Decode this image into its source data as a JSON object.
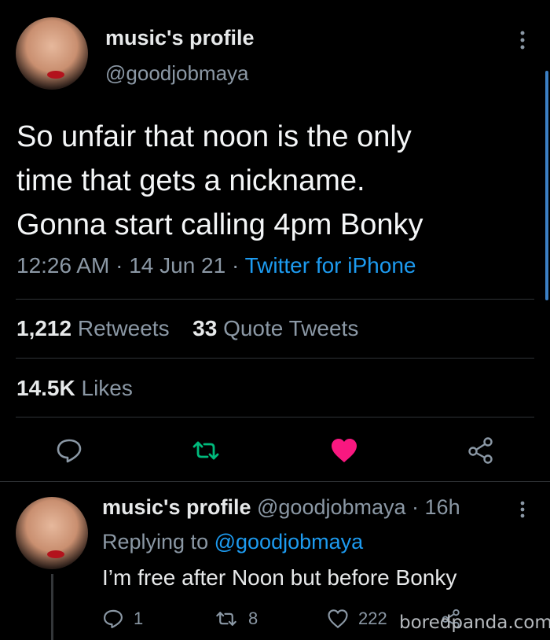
{
  "main_tweet": {
    "display_name": "music's profile",
    "handle": "@goodjobmaya",
    "text_lines": [
      "So unfair that noon is the only",
      "time that gets a nickname.",
      "Gonna start calling 4pm Bonky"
    ],
    "time": "12:26 AM",
    "date": "14 Jun 21",
    "source": "Twitter for iPhone",
    "retweets_count": "1,212",
    "retweets_label": "Retweets",
    "quotes_count": "33",
    "quotes_label": "Quote Tweets",
    "likes_count": "14.5K",
    "likes_label": "Likes"
  },
  "reply": {
    "display_name": "music's profile",
    "handle": "@goodjobmaya",
    "age": "· 16h",
    "replying_prefix": "Replying to",
    "replying_handle": "@goodjobmaya",
    "text": "I’m free after Noon but before Bonky",
    "reply_count": "1",
    "retweet_count": "8",
    "like_count": "222"
  },
  "watermark": "boredpanda.com",
  "colors": {
    "background": "#000000",
    "accent_blue": "#1d9bf0",
    "retweet_green": "#00ba7c",
    "like_pink": "#f91880"
  }
}
